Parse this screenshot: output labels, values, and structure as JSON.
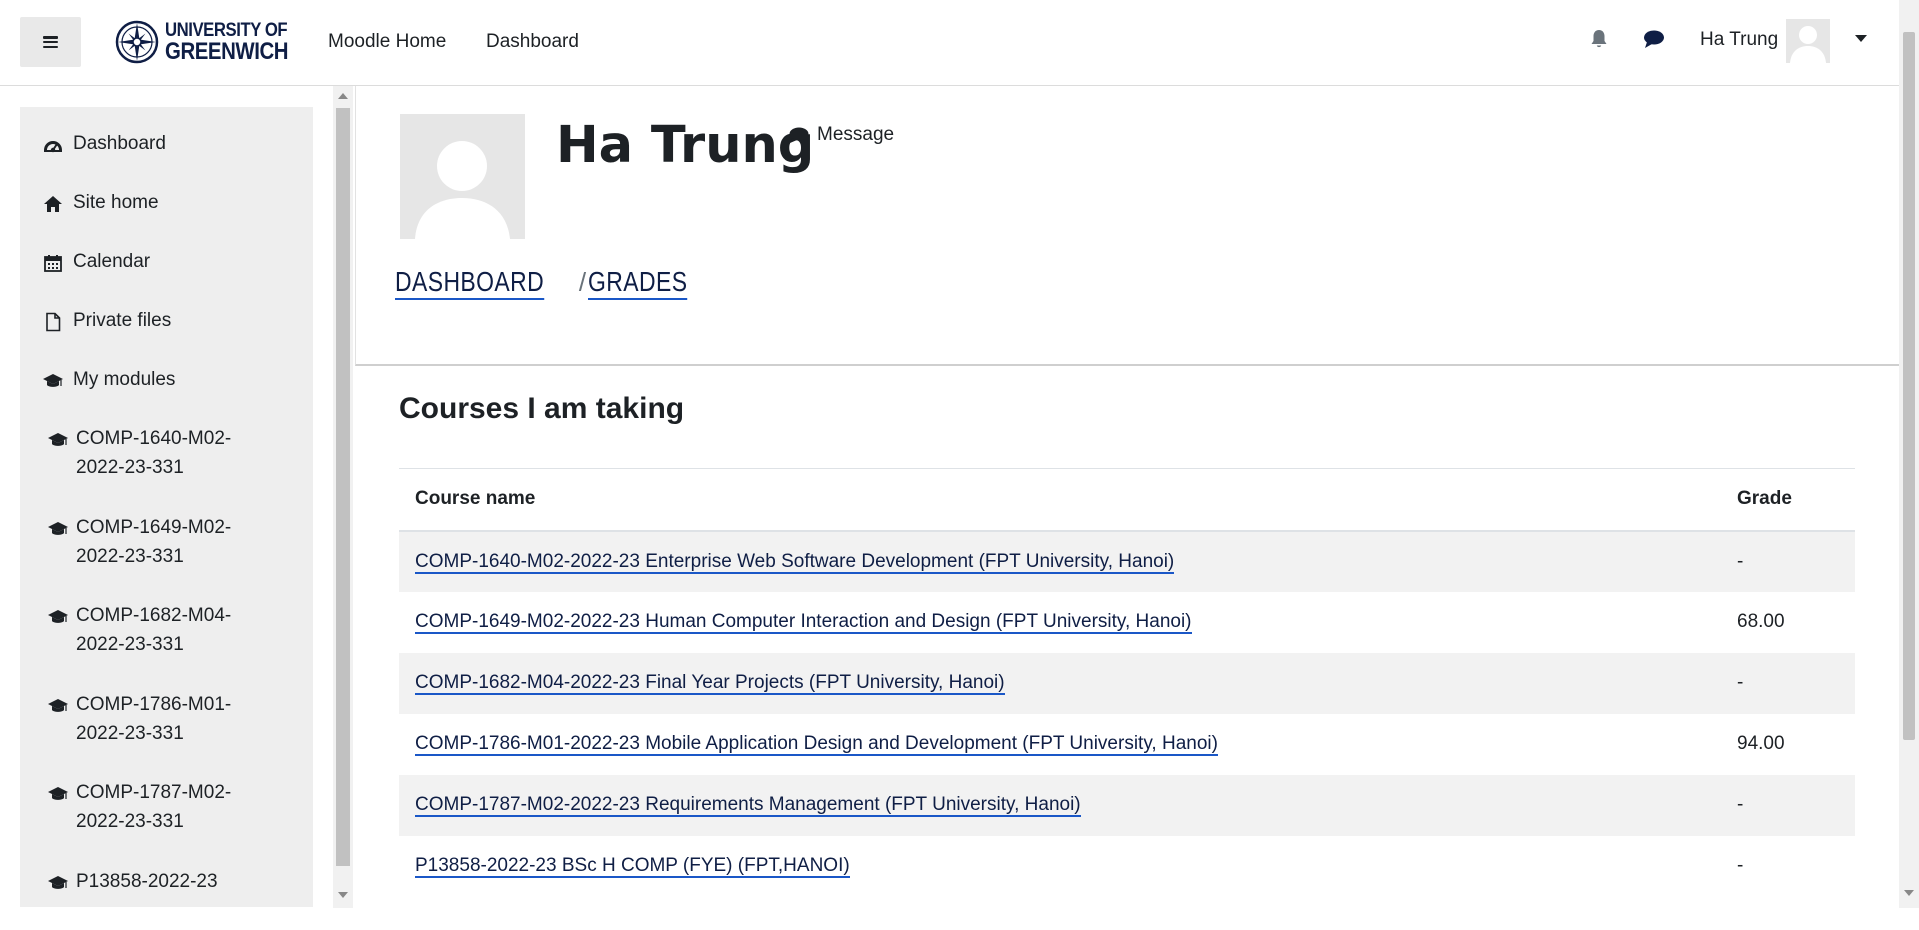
{
  "navbar": {
    "menu_toggle_icon": "hamburger-icon",
    "brand_line1": "UNIVERSITY OF",
    "brand_line2": "GREENWICH",
    "links": [
      "Moodle Home",
      "Dashboard"
    ],
    "notification_icon": "bell-icon",
    "messages_icon": "chat-bubble-icon",
    "user_name": "Ha Trung",
    "user_menu_icon": "caret-down-icon"
  },
  "drawer": {
    "items": [
      {
        "label": "Dashboard",
        "icon": "tachometer-icon"
      },
      {
        "label": "Site home",
        "icon": "home-icon"
      },
      {
        "label": "Calendar",
        "icon": "calendar-icon"
      },
      {
        "label": "Private files",
        "icon": "file-icon"
      },
      {
        "label": "My modules",
        "icon": "graduation-cap-icon"
      }
    ],
    "modules": [
      {
        "label": "COMP-1640-M02-2022-23-331",
        "icon": "graduation-cap-icon"
      },
      {
        "label": "COMP-1649-M02-2022-23-331",
        "icon": "graduation-cap-icon"
      },
      {
        "label": "COMP-1682-M04-2022-23-331",
        "icon": "graduation-cap-icon"
      },
      {
        "label": "COMP-1786-M01-2022-23-331",
        "icon": "graduation-cap-icon"
      },
      {
        "label": "COMP-1787-M02-2022-23-331",
        "icon": "graduation-cap-icon"
      },
      {
        "label": "P13858-2022-23",
        "icon": "graduation-cap-icon"
      }
    ]
  },
  "header": {
    "title": "Ha Trung",
    "message_label": "Message",
    "breadcrumb": [
      "DASHBOARD",
      "GRADES"
    ],
    "breadcrumb_separator": "/"
  },
  "main": {
    "section_title": "Courses I am taking",
    "columns": [
      "Course name",
      "Grade"
    ],
    "rows": [
      {
        "course": "COMP-1640-M02-2022-23 Enterprise Web Software Development (FPT University, Hanoi)",
        "grade": "-"
      },
      {
        "course": "COMP-1649-M02-2022-23 Human Computer Interaction and Design (FPT University, Hanoi)",
        "grade": "68.00"
      },
      {
        "course": "COMP-1682-M04-2022-23 Final Year Projects (FPT University, Hanoi)",
        "grade": "-"
      },
      {
        "course": "COMP-1786-M01-2022-23 Mobile Application Design and Development (FPT University, Hanoi)",
        "grade": "94.00"
      },
      {
        "course": "COMP-1787-M02-2022-23 Requirements Management (FPT University, Hanoi)",
        "grade": "-"
      },
      {
        "course": "P13858-2022-23 BSc H COMP (FYE) (FPT,HANOI)",
        "grade": "-"
      }
    ]
  },
  "colors": {
    "brand_navy": "#0f1e45",
    "link_underline": "#1a57c7",
    "drawer_bg": "#eeeeee",
    "row_stripe": "#f2f2f2"
  }
}
